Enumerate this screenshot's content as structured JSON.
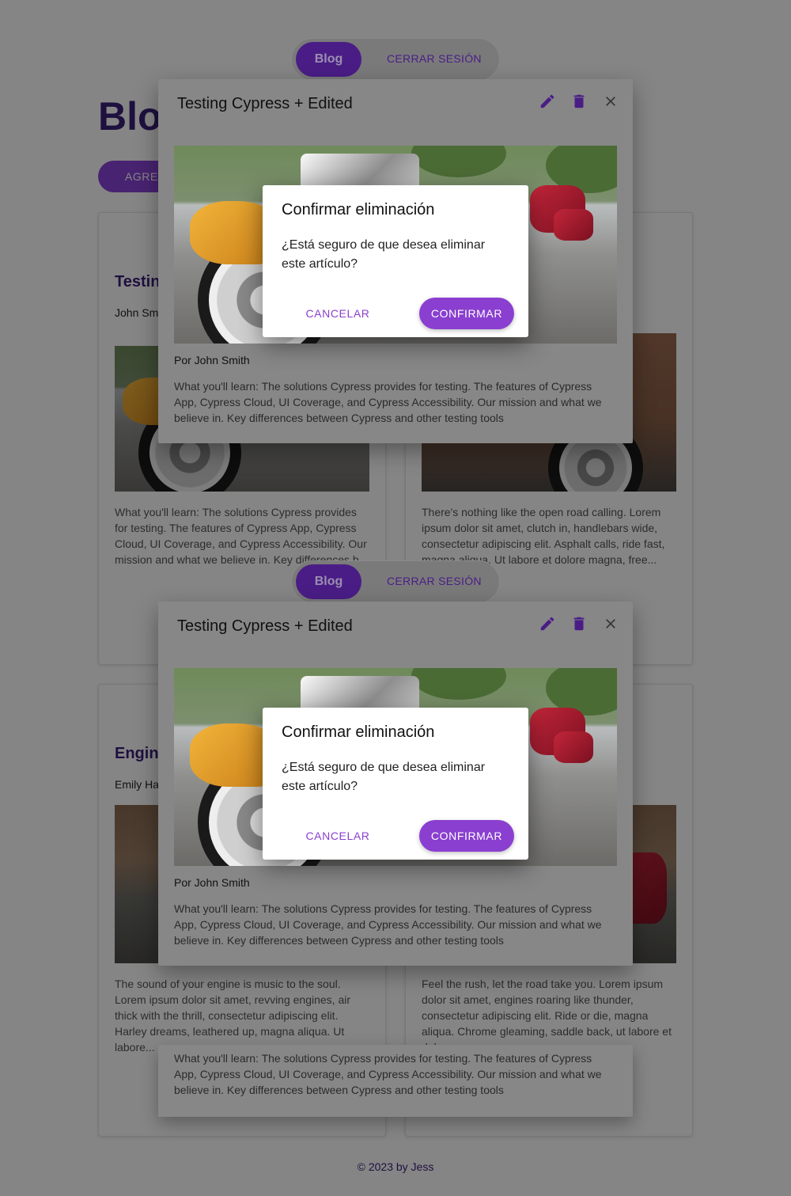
{
  "nav": {
    "blog_label": "Blog",
    "logout_label": "CERRAR SESIÓN"
  },
  "page": {
    "title": "Blog",
    "add_button": "AGREGAR"
  },
  "cards": [
    {
      "title": "Testing Cypress + Edited",
      "author": "John Smith",
      "excerpt": "What you'll learn: The solutions Cypress provides for testing. The features of Cypress App, Cypress Cloud, UI Coverage, and Cypress Accessibility. Our mission and what we believe in. Key differences b..."
    },
    {
      "title": "",
      "author": "",
      "excerpt": "There's nothing like the open road calling. Lorem ipsum dolor sit amet, clutch in, handlebars wide, consectetur adipiscing elit. Asphalt calls, ride fast, magna aliqua. Ut labore et dolore magna, free..."
    },
    {
      "title": "Engine",
      "author": "Emily Ha",
      "excerpt": "The sound of your engine is music to the soul. Lorem ipsum dolor sit amet, revving engines, air thick with the thrill, consectetur adipiscing elit. Harley dreams, leathered up, magna aliqua. Ut labore..."
    },
    {
      "title": "",
      "author": "",
      "excerpt": "Feel the rush, let the road take you. Lorem ipsum dolor sit amet, engines roaring like thunder, consectetur adipiscing elit. Ride or die, magna aliqua. Chrome gleaming, saddle back, ut labore et dolor..."
    }
  ],
  "dialog": {
    "title": "Testing Cypress + Edited",
    "author_line": "Por John Smith",
    "body": "What you'll learn: The solutions Cypress provides for testing. The features of Cypress App, Cypress Cloud, UI Coverage, and Cypress Accessibility. Our mission and what we believe in. Key differences between Cypress and other testing tools",
    "icons": [
      "edit-icon",
      "delete-icon",
      "close-icon"
    ]
  },
  "confirm": {
    "title": "Confirmar eliminación",
    "message": "¿Está seguro de que desea eliminar este artículo?",
    "cancel": "CANCELAR",
    "confirm": "CONFIRMAR"
  },
  "footer": "© 2023 by Jess",
  "colors": {
    "accent": "#8a3fd0",
    "title": "#3a1f7a",
    "dialog_bg": "#878787"
  }
}
